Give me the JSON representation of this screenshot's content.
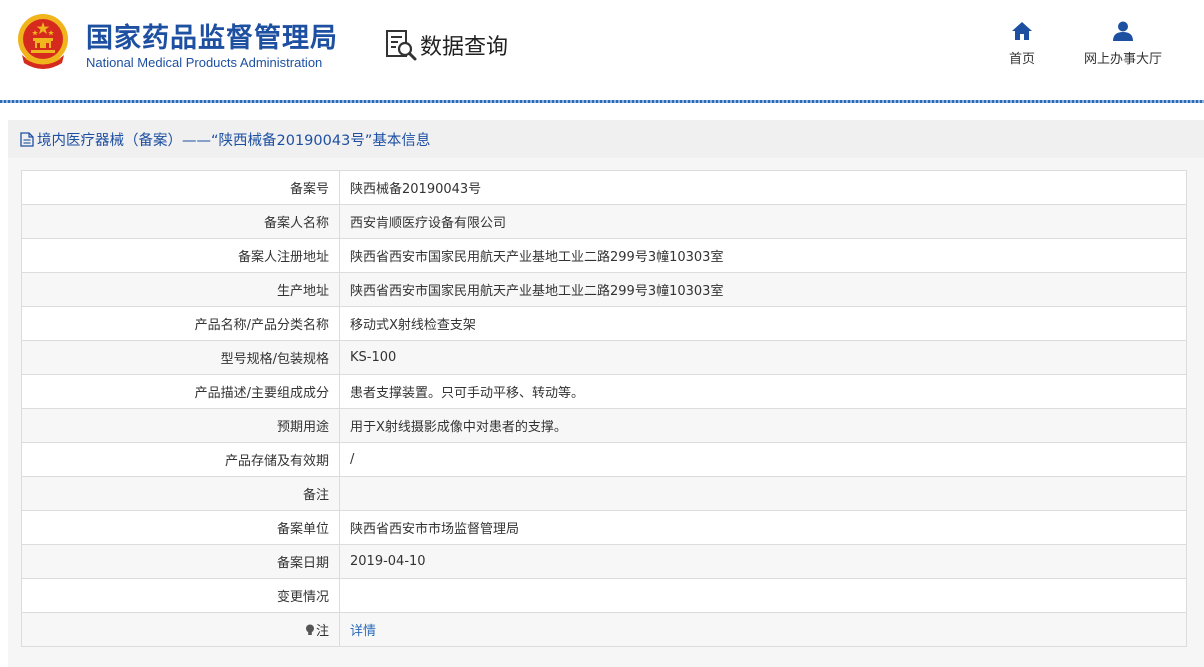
{
  "header": {
    "brand_cn": "国家药品监督管理局",
    "brand_en": "National Medical Products Administration",
    "query_label": "数据查询",
    "nav": [
      {
        "label": "首页",
        "icon": "home-icon"
      },
      {
        "label": "网上办事大厅",
        "icon": "user-icon"
      }
    ]
  },
  "title": "境内医疗器械（备案）——“陕西械备20190043号”基本信息",
  "rows": [
    {
      "key": "备案号",
      "value": "陕西械备20190043号"
    },
    {
      "key": "备案人名称",
      "value": "西安肯顺医疗设备有限公司"
    },
    {
      "key": "备案人注册地址",
      "value": "陕西省西安市国家民用航天产业基地工业二路299号3幢10303室"
    },
    {
      "key": "生产地址",
      "value": "陕西省西安市国家民用航天产业基地工业二路299号3幢10303室"
    },
    {
      "key": "产品名称/产品分类名称",
      "value": "移动式X射线检查支架"
    },
    {
      "key": "型号规格/包装规格",
      "value": "KS-100"
    },
    {
      "key": "产品描述/主要组成成分",
      "value": "患者支撑装置。只可手动平移、转动等。"
    },
    {
      "key": "预期用途",
      "value": "用于X射线摄影成像中对患者的支撑。"
    },
    {
      "key": "产品存储及有效期",
      "value": "/"
    },
    {
      "key": "备注",
      "value": ""
    },
    {
      "key": "备案单位",
      "value": "陕西省西安市市场监督管理局"
    },
    {
      "key": "备案日期",
      "value": "2019-04-10"
    },
    {
      "key": "变更情况",
      "value": ""
    }
  ],
  "note_row": {
    "key": "注",
    "link": "详情",
    "icon": "lightbulb-icon"
  },
  "colors": {
    "brand_blue": "#1e50a2",
    "link_blue": "#2a6bb8",
    "emblem_red": "#d62a1e",
    "emblem_gold": "#f0b51c"
  }
}
